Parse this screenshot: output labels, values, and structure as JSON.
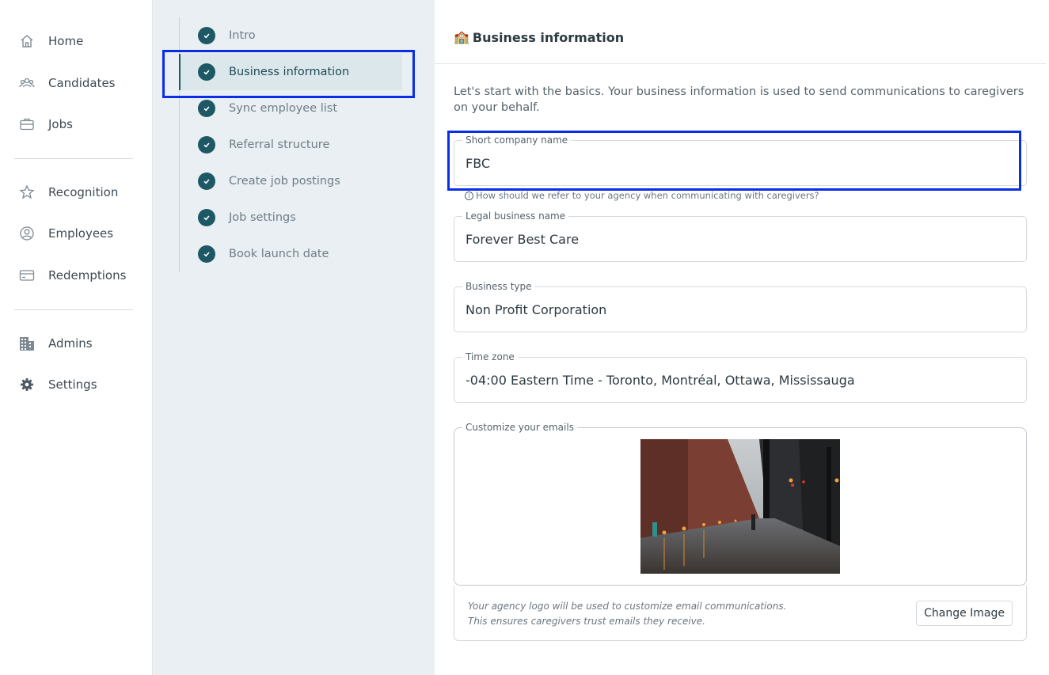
{
  "nav": {
    "items": [
      {
        "label": "Home",
        "icon": "home-icon"
      },
      {
        "label": "Candidates",
        "icon": "people-icon"
      },
      {
        "label": "Jobs",
        "icon": "briefcase-icon"
      },
      {
        "label": "Recognition",
        "icon": "star-icon"
      },
      {
        "label": "Employees",
        "icon": "user-circle-icon"
      },
      {
        "label": "Redemptions",
        "icon": "credit-card-icon"
      },
      {
        "label": "Admins",
        "icon": "building-icon"
      },
      {
        "label": "Settings",
        "icon": "gear-icon"
      }
    ]
  },
  "steps": {
    "items": [
      {
        "label": "Intro"
      },
      {
        "label": "Business information"
      },
      {
        "label": "Sync employee list"
      },
      {
        "label": "Referral structure"
      },
      {
        "label": "Create job postings"
      },
      {
        "label": "Job settings"
      },
      {
        "label": "Book launch date"
      }
    ],
    "active": "Business information"
  },
  "card": {
    "emoji": "🏫",
    "title": "Business information",
    "intro": "Let's start with the basics. Your business information is used to send communications to caregivers on your behalf.",
    "fields": {
      "short_name": {
        "label": "Short company name",
        "value": "FBC"
      },
      "short_name_hint": "How should we refer to your agency when communicating with caregivers?",
      "legal_name": {
        "label": "Legal business name",
        "value": "Forever Best Care"
      },
      "business_type": {
        "label": "Business type",
        "value": "Non Profit Corporation"
      },
      "time_zone": {
        "label": "Time zone",
        "value": "-04:00 Eastern Time - Toronto, Montréal, Ottawa, Mississauga"
      }
    },
    "emails": {
      "label": "Customize your emails",
      "note_line1": "Your agency logo will be used to customize email communications.",
      "note_line2": "This ensures caregivers trust emails they receive.",
      "change_button": "Change Image"
    }
  },
  "colors": {
    "accent": "#1d5864",
    "highlight": "#0a2ee6",
    "steps_bg": "#e9eff2"
  }
}
